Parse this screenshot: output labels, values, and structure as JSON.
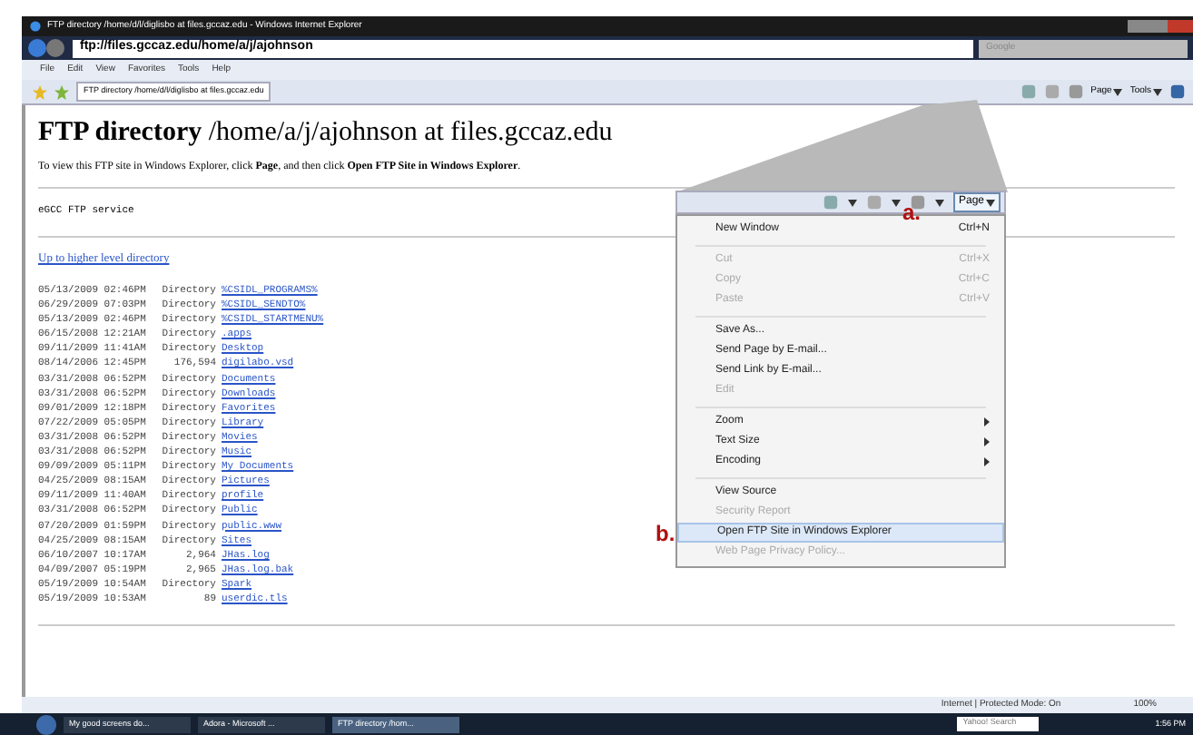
{
  "window": {
    "title": "FTP directory /home/d/l/diglisbo at files.gccaz.edu - Windows Internet Explorer"
  },
  "address_bar": {
    "value": "ftp://files.gccaz.edu/home/a/j/ajohnson"
  },
  "search": {
    "placeholder": "Google"
  },
  "menu_bar": [
    "File",
    "Edit",
    "View",
    "Favorites",
    "Tools",
    "Help"
  ],
  "tab": {
    "label": "FTP directory /home/d/l/diglisbo at files.gccaz.edu"
  },
  "toolbar": {
    "page": "Page",
    "tools": "Tools"
  },
  "page": {
    "heading_bold": "FTP directory",
    "heading_path": "/home/a/j/ajohnson at files.gccaz.edu",
    "instruction": "To view this FTP site in Windows Explorer, click **Page**, and then click **Open FTP Site in Windows Explorer**.",
    "service": "eGCC FTP service",
    "up_link": "Up to higher level directory",
    "rows": [
      {
        "date": "05/13/2009 02:46PM",
        "size": "Directory",
        "name": "%CSIDL_PROGRAMS%"
      },
      {
        "date": "06/29/2009 07:03PM",
        "size": "Directory",
        "name": "%CSIDL_SENDTO%"
      },
      {
        "date": "05/13/2009 02:46PM",
        "size": "Directory",
        "name": "%CSIDL_STARTMENU%"
      },
      {
        "date": "06/15/2008 12:21AM",
        "size": "Directory",
        "name": ".apps"
      },
      {
        "date": "09/11/2009 11:41AM",
        "size": "Directory",
        "name": "Desktop"
      },
      {
        "date": "08/14/2006 12:45PM",
        "size": "176,594",
        "name": "digilabo.vsd"
      },
      {
        "date": "03/31/2008 06:52PM",
        "size": "Directory",
        "name": "Documents"
      },
      {
        "date": "03/31/2008 06:52PM",
        "size": "Directory",
        "name": "Downloads"
      },
      {
        "date": "09/01/2009 12:18PM",
        "size": "Directory",
        "name": "Favorites"
      },
      {
        "date": "07/22/2009 05:05PM",
        "size": "Directory",
        "name": "Library"
      },
      {
        "date": "03/31/2008 06:52PM",
        "size": "Directory",
        "name": "Movies"
      },
      {
        "date": "03/31/2008 06:52PM",
        "size": "Directory",
        "name": "Music"
      },
      {
        "date": "09/09/2009 05:11PM",
        "size": "Directory",
        "name": "My Documents"
      },
      {
        "date": "04/25/2009 08:15AM",
        "size": "Directory",
        "name": "Pictures"
      },
      {
        "date": "09/11/2009 11:40AM",
        "size": "Directory",
        "name": "profile"
      },
      {
        "date": "03/31/2008 06:52PM",
        "size": "Directory",
        "name": "Public"
      },
      {
        "date": "07/20/2009 01:59PM",
        "size": "Directory",
        "name": "public.www"
      },
      {
        "date": "04/25/2009 08:15AM",
        "size": "Directory",
        "name": "Sites"
      },
      {
        "date": "06/10/2007 10:17AM",
        "size": "2,964",
        "name": "JHas.log"
      },
      {
        "date": "04/09/2007 05:19PM",
        "size": "2,965",
        "name": "JHas.log.bak"
      },
      {
        "date": "05/19/2009 10:54AM",
        "size": "Directory",
        "name": "Spark"
      },
      {
        "date": "05/19/2009 10:53AM",
        "size": "89",
        "name": "userdic.tls"
      }
    ]
  },
  "callout": {
    "page_button": "Page",
    "label_a": "a.",
    "label_b": "b.",
    "menu": [
      {
        "kind": "item",
        "label": "New Window",
        "shortcut": "Ctrl+N",
        "disabled": false,
        "selected": false
      },
      {
        "kind": "separator"
      },
      {
        "kind": "item",
        "label": "Cut",
        "shortcut": "Ctrl+X",
        "disabled": true,
        "selected": false
      },
      {
        "kind": "item",
        "label": "Copy",
        "shortcut": "Ctrl+C",
        "disabled": true,
        "selected": false
      },
      {
        "kind": "item",
        "label": "Paste",
        "shortcut": "Ctrl+V",
        "disabled": true,
        "selected": false
      },
      {
        "kind": "separator"
      },
      {
        "kind": "item",
        "label": "Save As...",
        "disabled": false,
        "selected": false
      },
      {
        "kind": "item",
        "label": "Send Page by E-mail...",
        "disabled": false,
        "selected": false
      },
      {
        "kind": "item",
        "label": "Send Link by E-mail...",
        "disabled": false,
        "selected": false
      },
      {
        "kind": "item",
        "label": "Edit",
        "disabled": true,
        "selected": false
      },
      {
        "kind": "separator"
      },
      {
        "kind": "submenu",
        "label": "Zoom",
        "disabled": false,
        "selected": false
      },
      {
        "kind": "submenu",
        "label": "Text Size",
        "disabled": false,
        "selected": false
      },
      {
        "kind": "submenu",
        "label": "Encoding",
        "disabled": false,
        "selected": false
      },
      {
        "kind": "separator"
      },
      {
        "kind": "item",
        "label": "View Source",
        "disabled": false,
        "selected": false
      },
      {
        "kind": "item",
        "label": "Security Report",
        "disabled": true,
        "selected": false
      },
      {
        "kind": "item",
        "label": "Open FTP Site in Windows Explorer",
        "disabled": false,
        "selected": true
      },
      {
        "kind": "item",
        "label": "Web Page Privacy Policy...",
        "disabled": true,
        "selected": false
      }
    ]
  },
  "status_bar": {
    "zone": "Internet | Protected Mode: On",
    "zoom": "100%"
  },
  "taskbar": {
    "items": [
      {
        "label": "My good screens do...",
        "selected": false
      },
      {
        "label": "Adora - Microsoft ...",
        "selected": false
      },
      {
        "label": "FTP directory /hom...",
        "selected": true
      }
    ],
    "search": "Yahoo! Search",
    "clock": "1:56 PM"
  }
}
